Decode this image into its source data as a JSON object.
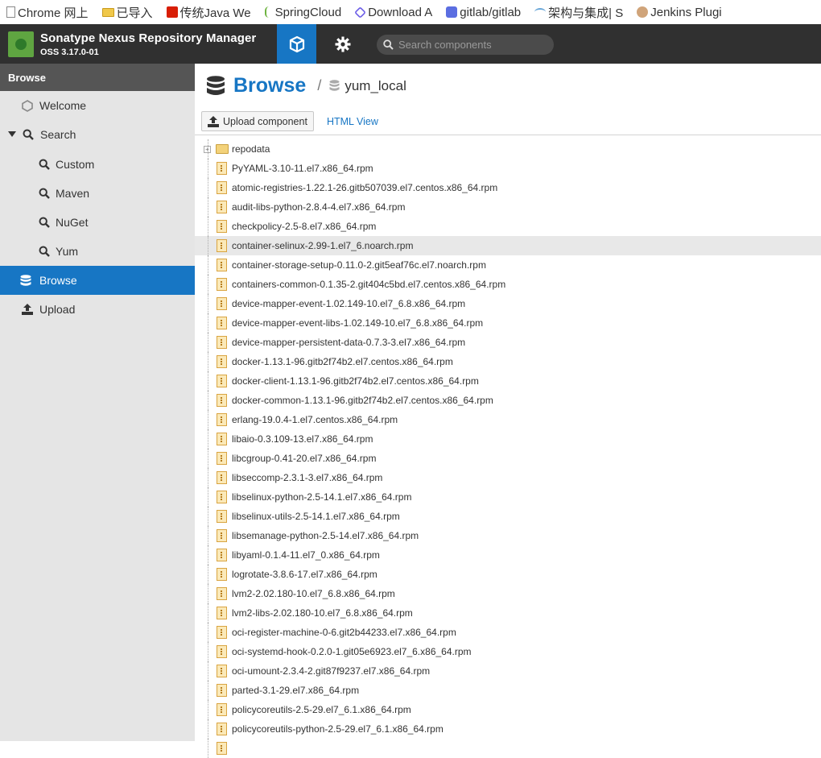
{
  "bookmarks": [
    {
      "label": "Chrome 网上",
      "icon": "page-icon"
    },
    {
      "label": "已导入",
      "icon": "folder-icon"
    },
    {
      "label": "传统Java We",
      "icon": "csdn-icon"
    },
    {
      "label": "SpringCloud",
      "icon": "spring-icon"
    },
    {
      "label": "Download A",
      "icon": "hexagon-icon"
    },
    {
      "label": "gitlab/gitlab",
      "icon": "gitlab-icon"
    },
    {
      "label": "架构与集成| S",
      "icon": "wave-icon"
    },
    {
      "label": "Jenkins Plugi",
      "icon": "jenkins-icon"
    }
  ],
  "header": {
    "title": "Sonatype Nexus Repository Manager",
    "version": "OSS 3.17.0-01",
    "search_placeholder": "Search components"
  },
  "sidebar": {
    "heading": "Browse",
    "items": [
      {
        "label": "Welcome",
        "icon": "hexagon-icon"
      },
      {
        "label": "Search",
        "icon": "search-icon"
      },
      {
        "label": "Custom",
        "icon": "search-icon"
      },
      {
        "label": "Maven",
        "icon": "search-icon"
      },
      {
        "label": "NuGet",
        "icon": "search-icon"
      },
      {
        "label": "Yum",
        "icon": "search-icon"
      },
      {
        "label": "Browse",
        "icon": "database-icon"
      },
      {
        "label": "Upload",
        "icon": "upload-icon"
      }
    ]
  },
  "main": {
    "title": "Browse",
    "separator": "/",
    "repository": "yum_local",
    "upload_button": "Upload component",
    "html_view": "HTML View",
    "tree": [
      {
        "name": "repodata",
        "type": "folder"
      },
      {
        "name": "PyYAML-3.10-11.el7.x86_64.rpm",
        "type": "file"
      },
      {
        "name": "atomic-registries-1.22.1-26.gitb507039.el7.centos.x86_64.rpm",
        "type": "file"
      },
      {
        "name": "audit-libs-python-2.8.4-4.el7.x86_64.rpm",
        "type": "file"
      },
      {
        "name": "checkpolicy-2.5-8.el7.x86_64.rpm",
        "type": "file"
      },
      {
        "name": "container-selinux-2.99-1.el7_6.noarch.rpm",
        "type": "file",
        "selected": true
      },
      {
        "name": "container-storage-setup-0.11.0-2.git5eaf76c.el7.noarch.rpm",
        "type": "file"
      },
      {
        "name": "containers-common-0.1.35-2.git404c5bd.el7.centos.x86_64.rpm",
        "type": "file"
      },
      {
        "name": "device-mapper-event-1.02.149-10.el7_6.8.x86_64.rpm",
        "type": "file"
      },
      {
        "name": "device-mapper-event-libs-1.02.149-10.el7_6.8.x86_64.rpm",
        "type": "file"
      },
      {
        "name": "device-mapper-persistent-data-0.7.3-3.el7.x86_64.rpm",
        "type": "file"
      },
      {
        "name": "docker-1.13.1-96.gitb2f74b2.el7.centos.x86_64.rpm",
        "type": "file"
      },
      {
        "name": "docker-client-1.13.1-96.gitb2f74b2.el7.centos.x86_64.rpm",
        "type": "file"
      },
      {
        "name": "docker-common-1.13.1-96.gitb2f74b2.el7.centos.x86_64.rpm",
        "type": "file"
      },
      {
        "name": "erlang-19.0.4-1.el7.centos.x86_64.rpm",
        "type": "file"
      },
      {
        "name": "libaio-0.3.109-13.el7.x86_64.rpm",
        "type": "file"
      },
      {
        "name": "libcgroup-0.41-20.el7.x86_64.rpm",
        "type": "file"
      },
      {
        "name": "libseccomp-2.3.1-3.el7.x86_64.rpm",
        "type": "file"
      },
      {
        "name": "libselinux-python-2.5-14.1.el7.x86_64.rpm",
        "type": "file"
      },
      {
        "name": "libselinux-utils-2.5-14.1.el7.x86_64.rpm",
        "type": "file"
      },
      {
        "name": "libsemanage-python-2.5-14.el7.x86_64.rpm",
        "type": "file"
      },
      {
        "name": "libyaml-0.1.4-11.el7_0.x86_64.rpm",
        "type": "file"
      },
      {
        "name": "logrotate-3.8.6-17.el7.x86_64.rpm",
        "type": "file"
      },
      {
        "name": "lvm2-2.02.180-10.el7_6.8.x86_64.rpm",
        "type": "file"
      },
      {
        "name": "lvm2-libs-2.02.180-10.el7_6.8.x86_64.rpm",
        "type": "file"
      },
      {
        "name": "oci-register-machine-0-6.git2b44233.el7.x86_64.rpm",
        "type": "file"
      },
      {
        "name": "oci-systemd-hook-0.2.0-1.git05e6923.el7_6.x86_64.rpm",
        "type": "file"
      },
      {
        "name": "oci-umount-2.3.4-2.git87f9237.el7.x86_64.rpm",
        "type": "file"
      },
      {
        "name": "parted-3.1-29.el7.x86_64.rpm",
        "type": "file"
      },
      {
        "name": "policycoreutils-2.5-29.el7_6.1.x86_64.rpm",
        "type": "file"
      },
      {
        "name": "policycoreutils-python-2.5-29.el7_6.1.x86_64.rpm",
        "type": "file"
      },
      {
        "name": "",
        "type": "file"
      }
    ]
  },
  "colors": {
    "accent": "#1776c4",
    "header_bg": "#303030",
    "sidebar_bg": "#e5e5e5",
    "selected_row": "#e8e8e8"
  }
}
